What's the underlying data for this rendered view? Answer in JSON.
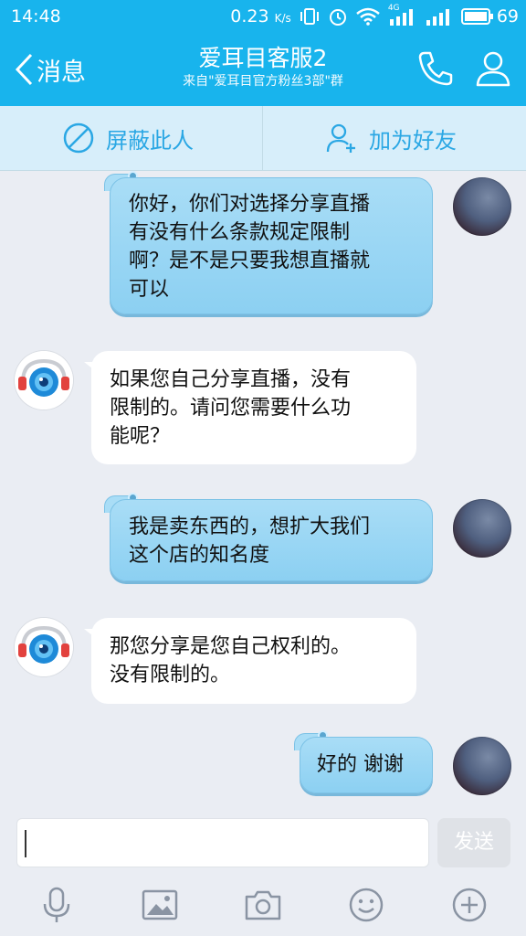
{
  "status_bar": {
    "time": "14:48",
    "net_speed": "0.23",
    "net_unit": "K/s",
    "network_type": "4G",
    "battery": "69"
  },
  "header": {
    "back_label": "消息",
    "title": "爱耳目客服2",
    "subtitle": "来自\"爱耳目官方粉丝3部\"群"
  },
  "actions": {
    "block_label": "屏蔽此人",
    "add_friend_label": "加为好友"
  },
  "messages": [
    {
      "side": "out",
      "text_lines": [
        "你好，你们对选择分享直播",
        "有没有什么条款规定限制",
        "啊？是不是只要我想直播就",
        "可以"
      ]
    },
    {
      "side": "in",
      "text_lines": [
        "如果您自己分享直播，没有",
        "限制的。请问您需要什么功",
        "能呢？"
      ]
    },
    {
      "side": "out",
      "text_lines": [
        "我是卖东西的，想扩大我们",
        "这个店的知名度"
      ]
    },
    {
      "side": "in",
      "text_lines": [
        "那您分享是您自己权利的。",
        "没有限制的。"
      ]
    },
    {
      "side": "out",
      "text_lines": [
        "好的 谢谢"
      ]
    }
  ],
  "input": {
    "value": "",
    "send_label": "发送"
  },
  "toolbar_icons": [
    "microphone-icon",
    "image-icon",
    "camera-icon",
    "emoji-icon",
    "plus-icon"
  ],
  "colors": {
    "header_bg": "#18b4ed",
    "action_bar_bg": "#d7eefa",
    "accent": "#2aa7e4",
    "outgoing_bubble": "#a9ddf6",
    "incoming_bubble": "#ffffff",
    "chat_bg": "#eaedf3"
  }
}
